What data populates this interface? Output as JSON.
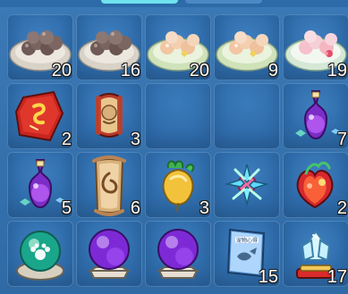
{
  "inventory": {
    "rows": [
      [
        {
          "icon": "dark-dumplings-plate-icon",
          "count": "20"
        },
        {
          "icon": "dark-dumplings-plate-icon",
          "count": "16"
        },
        {
          "icon": "sweet-buns-plate-icon",
          "count": "20"
        },
        {
          "icon": "sweet-buns-plate-icon",
          "count": "9"
        },
        {
          "icon": "peach-buns-plate-icon",
          "count": "19"
        }
      ],
      [
        {
          "icon": "red-rune-stone-icon",
          "count": "2"
        },
        {
          "icon": "scroll-of-portrait-icon",
          "count": "3"
        },
        {
          "icon": "",
          "count": ""
        },
        {
          "icon": "",
          "count": ""
        },
        {
          "icon": "purple-potion-vase-icon",
          "count": "7"
        }
      ],
      [
        {
          "icon": "purple-potion-vase-icon",
          "count": "5"
        },
        {
          "icon": "ancient-scroll-icon",
          "count": "6"
        },
        {
          "icon": "golden-radish-icon",
          "count": "3"
        },
        {
          "icon": "crystal-flower-icon",
          "count": ""
        },
        {
          "icon": "flame-heart-orb-icon",
          "count": "2"
        }
      ],
      [
        {
          "icon": "paw-green-orb-icon",
          "count": ""
        },
        {
          "icon": "purple-orb-on-stand-icon",
          "count": ""
        },
        {
          "icon": "purple-orb-on-stand-icon",
          "count": ""
        },
        {
          "icon": "blue-pet-book-icon",
          "count": "15"
        },
        {
          "icon": "ice-crystal-pedestal-icon",
          "count": "17"
        }
      ]
    ],
    "book_title": "宠物心得"
  }
}
